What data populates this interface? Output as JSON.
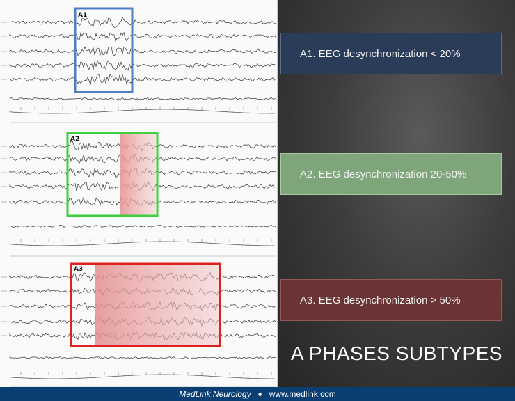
{
  "panels": [
    {
      "label": "A1",
      "caption": "A1. EEG desynchronization  < 20%",
      "color": "#4f7fc2"
    },
    {
      "label": "A2",
      "caption": "A2. EEG desynchronization  20-50%",
      "color": "#3fcf3f"
    },
    {
      "label": "A3",
      "caption": "A3. EEG desynchronization  > 50%",
      "color": "#e02020"
    }
  ],
  "title": "A PHASES SUBTYPES",
  "footer": {
    "brand": "MedLink Neurology",
    "separator": "♦",
    "url": "www.medlink.com"
  }
}
